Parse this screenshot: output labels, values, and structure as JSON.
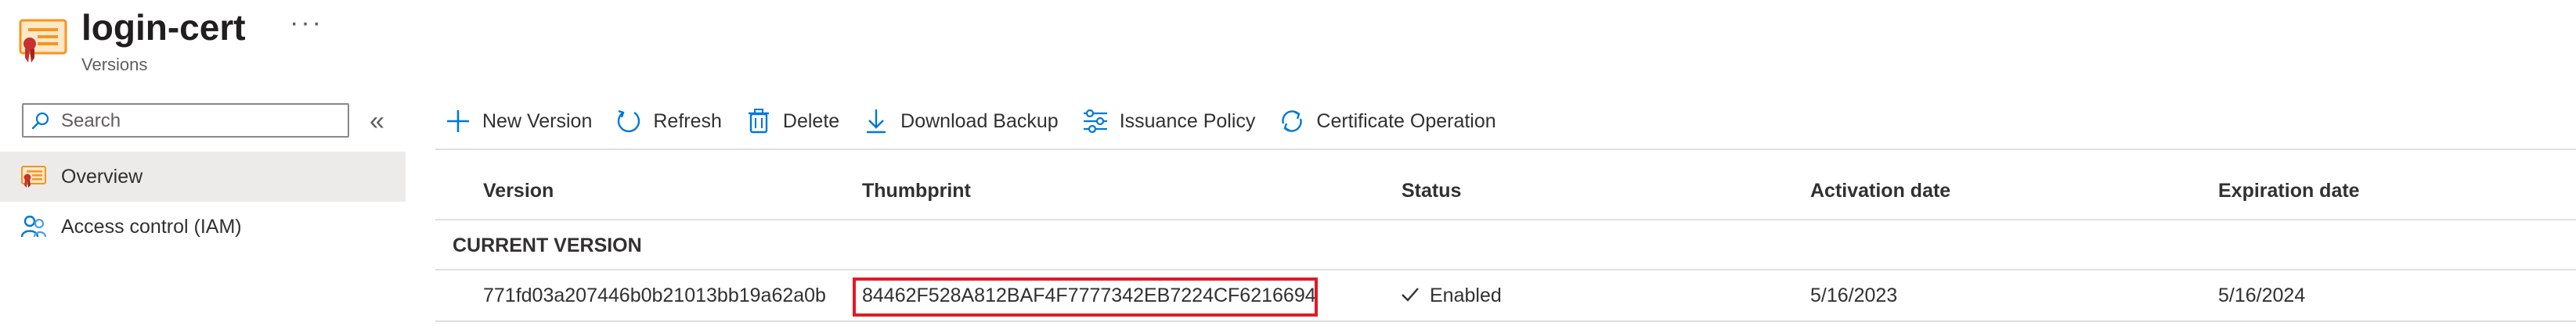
{
  "header": {
    "title": "login-cert",
    "subtitle": "Versions",
    "more_label": "···"
  },
  "sidebar": {
    "search_placeholder": "Search",
    "collapse_label": "«",
    "items": [
      {
        "label": "Overview",
        "icon": "overview-icon",
        "active": true
      },
      {
        "label": "Access control (IAM)",
        "icon": "iam-icon",
        "active": false
      }
    ]
  },
  "toolbar": {
    "buttons": [
      {
        "label": "New Version",
        "icon": "plus-icon"
      },
      {
        "label": "Refresh",
        "icon": "refresh-icon"
      },
      {
        "label": "Delete",
        "icon": "trash-icon"
      },
      {
        "label": "Download Backup",
        "icon": "download-icon"
      },
      {
        "label": "Issuance Policy",
        "icon": "sliders-icon"
      },
      {
        "label": "Certificate Operation",
        "icon": "cycle-icon"
      }
    ]
  },
  "table": {
    "columns": [
      "Version",
      "Thumbprint",
      "Status",
      "Activation date",
      "Expiration date"
    ],
    "group_label": "CURRENT VERSION",
    "rows": [
      {
        "version": "771fd03a207446b0b21013bb19a62a0b",
        "thumbprint": "84462F528A812BAF4F7777342EB7224CF6216694",
        "status": "Enabled",
        "activation": "5/16/2023",
        "expiration": "5/16/2024"
      }
    ]
  },
  "colors": {
    "accent": "#0078d4",
    "highlight_border": "#e01b24",
    "cert_icon_orange": "#f7941d",
    "cert_icon_ribbon": "#c8312d"
  }
}
